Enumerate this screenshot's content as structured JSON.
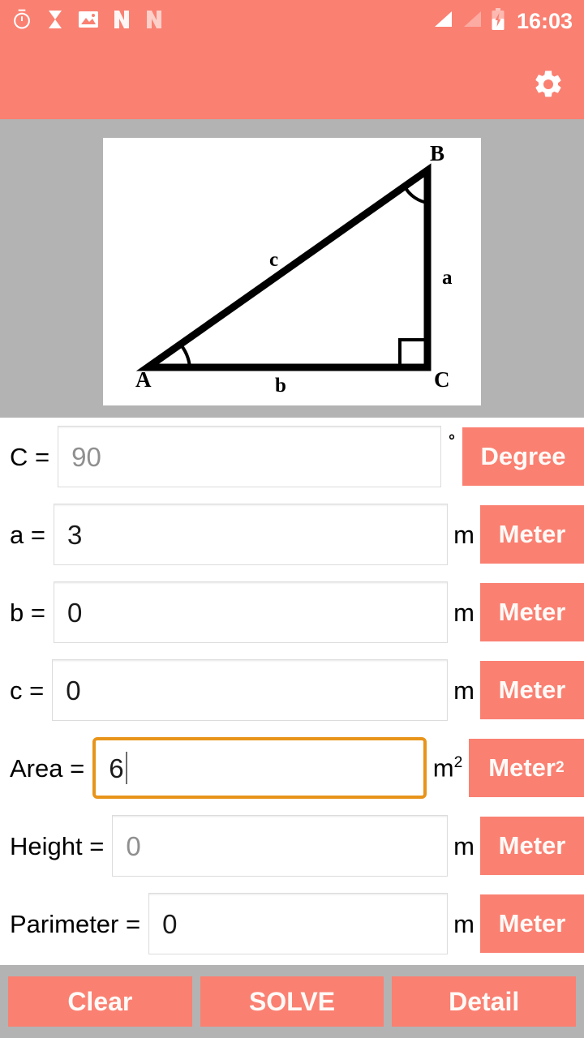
{
  "theme": {
    "accent": "#fa8072",
    "background_gray": "#b3b3b3",
    "focus_border": "#e8941a",
    "text": "#000000",
    "placeholder_text": "#8f8f8f",
    "button_text": "#fffaf7"
  },
  "statusbar": {
    "icons_left": [
      "alarm-clock-icon",
      "hourglass-icon",
      "image-icon",
      "nimbus-note-icon",
      "nimbus-note-icon-dim"
    ],
    "icons_right": [
      "signal-full-icon",
      "signal-empty-icon",
      "battery-charging-icon"
    ],
    "time": "16:03"
  },
  "appbar": {
    "settings_icon": "gear-icon"
  },
  "diagram": {
    "name": "right-triangle-diagram",
    "vertices": [
      "A",
      "B",
      "C"
    ],
    "side_labels": [
      "a",
      "b",
      "c"
    ],
    "right_angle_at": "C"
  },
  "form": {
    "rows": [
      {
        "id": "C",
        "label": "C =",
        "value": "90",
        "is_placeholder": true,
        "focused": false,
        "unit": "°",
        "unit_is_degree": true,
        "button_label": "Degree",
        "button_sup": ""
      },
      {
        "id": "a",
        "label": "a =",
        "value": "3",
        "is_placeholder": false,
        "focused": false,
        "unit": "m",
        "unit_is_degree": false,
        "button_label": "Meter",
        "button_sup": ""
      },
      {
        "id": "b",
        "label": "b =",
        "value": "0",
        "is_placeholder": false,
        "focused": false,
        "unit": "m",
        "unit_is_degree": false,
        "button_label": "Meter",
        "button_sup": ""
      },
      {
        "id": "c",
        "label": "c =",
        "value": "0",
        "is_placeholder": false,
        "focused": false,
        "unit": "m",
        "unit_is_degree": false,
        "button_label": "Meter",
        "button_sup": ""
      },
      {
        "id": "area",
        "label": "Area =",
        "value": "6",
        "is_placeholder": false,
        "focused": true,
        "unit": "m",
        "unit_sup": "2",
        "unit_is_degree": false,
        "button_label": "Meter",
        "button_sup": "2"
      },
      {
        "id": "height",
        "label": "Height =",
        "value": "0",
        "is_placeholder": true,
        "focused": false,
        "unit": "m",
        "unit_is_degree": false,
        "button_label": "Meter",
        "button_sup": ""
      },
      {
        "id": "perimeter",
        "label": "Parimeter =",
        "value": "0",
        "is_placeholder": false,
        "focused": false,
        "unit": "m",
        "unit_is_degree": false,
        "button_label": "Meter",
        "button_sup": ""
      }
    ]
  },
  "footer": {
    "buttons": [
      {
        "id": "clear",
        "label": "Clear"
      },
      {
        "id": "solve",
        "label": "SOLVE"
      },
      {
        "id": "detail",
        "label": "Detail"
      }
    ]
  }
}
